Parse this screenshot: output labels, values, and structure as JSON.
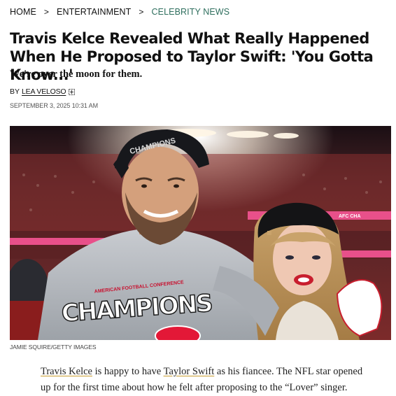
{
  "breadcrumb": {
    "items": [
      {
        "label": "HOME"
      },
      {
        "label": "ENTERTAINMENT"
      },
      {
        "label": "CELEBRITY NEWS"
      }
    ],
    "separator": ">"
  },
  "article": {
    "title": "Travis Kelce Revealed What Really Happened When He Proposed to Taylor Swift: 'You Gotta Know...'",
    "dek": "We're over the moon for them.",
    "byline_prefix": "BY",
    "author": "LEA VELOSO",
    "date": "SEPTEMBER 3, 2025 10:31 AM",
    "image": {
      "alt": "Travis Kelce and Taylor Swift on the field after the AFC Championship",
      "shirt_text_top": "AMERICAN FOOTBALL CONFERENCE",
      "shirt_text_main": "CHAMPIONS",
      "cap_text": "CHAMPIONS",
      "banner_text": "AFC CHA",
      "credit": "JAMIE SQUIRE/GETTY IMAGES"
    },
    "body": {
      "link1": "Travis Kelce",
      "text1": " is happy to have ",
      "link2": "Taylor Swift",
      "text2": " as his fiancee. The NFL star opened up for the first time about how he felt after proposing to the “Lover” singer."
    }
  },
  "colors": {
    "accent_breadcrumb": "#2f6f5e",
    "link_underline": "#c79b2d"
  },
  "icons": {
    "follow": "plus-square-icon"
  }
}
